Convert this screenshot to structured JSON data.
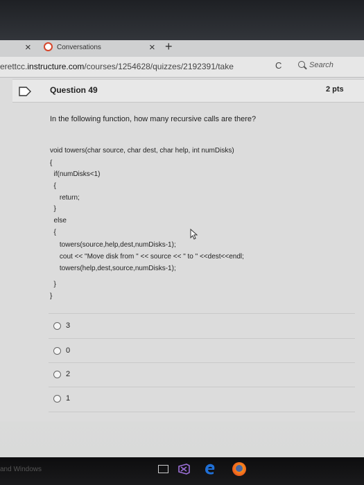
{
  "browser": {
    "tab_close_left": "×",
    "tab_title": "Conversations",
    "tab_close": "×",
    "new_tab": "+",
    "url_prefix": "erettcc.",
    "url_host": "instructure.com",
    "url_path": "/courses/1254628/quizzes/2192391/take",
    "refresh_glyph": "C",
    "search_placeholder": "Search"
  },
  "question": {
    "title": "Question 49",
    "points": "2 pts",
    "prompt": "In the following function, how many recursive calls are there?",
    "code_lines": [
      "void towers(char source, char dest, char help, int numDisks)",
      "{",
      "  if(numDisks<1)",
      "  {",
      "     return;",
      "  }",
      "  else",
      "  {",
      "     towers(source,help,dest,numDisks-1);",
      "     cout << \"Move disk from \" << source << \" to \" <<dest<<endl;",
      "     towers(help,dest,source,numDisks-1);",
      "",
      "  }",
      "}"
    ],
    "choices": [
      "3",
      "0",
      "2",
      "1"
    ]
  },
  "taskbar": {
    "label": "and Windows"
  },
  "colors": {
    "accent_red": "#d6452a",
    "edge_blue": "#1f6fd6",
    "vs_purple": "#7e4bb6"
  }
}
